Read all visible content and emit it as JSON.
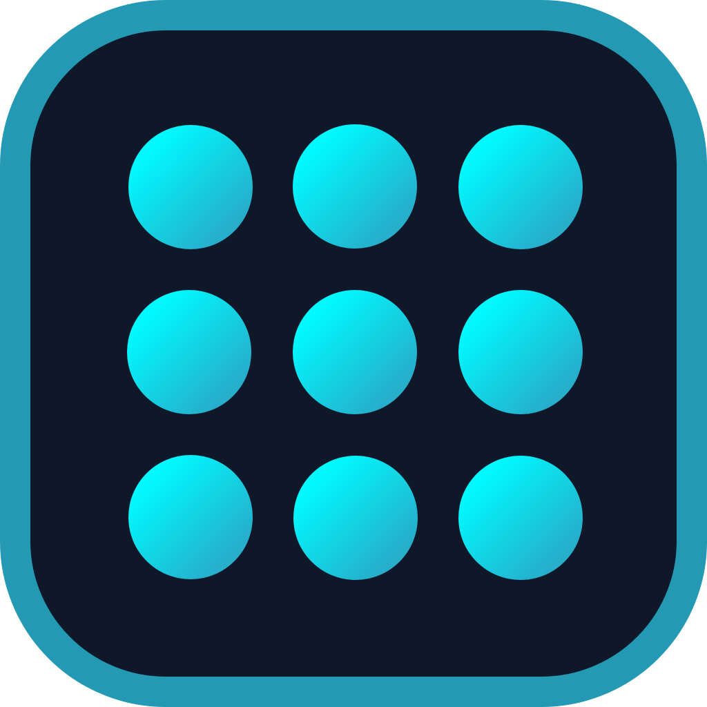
{
  "icon": {
    "name": "grid-of-dots-app-icon",
    "colors": {
      "frame": "#2499b4",
      "background": "#0f1828",
      "dot_light": "#00faff",
      "dot_dark": "#26aecb"
    },
    "grid": {
      "rows": 3,
      "columns": 3
    }
  }
}
